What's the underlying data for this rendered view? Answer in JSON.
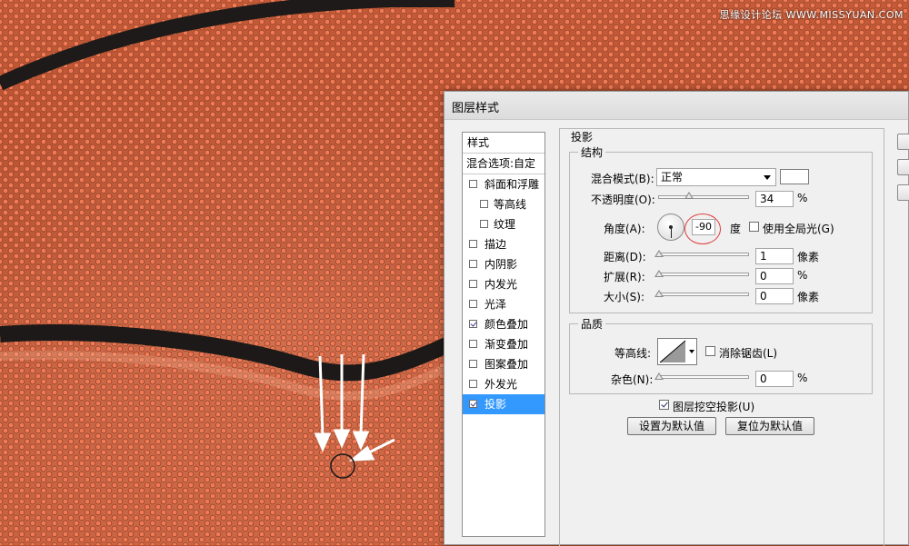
{
  "watermark": "思缘设计论坛 WWW.MISSYUAN.COM",
  "dialog": {
    "title": "图层样式"
  },
  "style_list": {
    "header": "样式",
    "blend_options": "混合选项:自定",
    "items": [
      {
        "label": "斜面和浮雕",
        "checked": false,
        "sub": false,
        "selected": false
      },
      {
        "label": "等高线",
        "checked": false,
        "sub": true,
        "selected": false
      },
      {
        "label": "纹理",
        "checked": false,
        "sub": true,
        "selected": false
      },
      {
        "label": "描边",
        "checked": false,
        "sub": false,
        "selected": false
      },
      {
        "label": "内阴影",
        "checked": false,
        "sub": false,
        "selected": false
      },
      {
        "label": "内发光",
        "checked": false,
        "sub": false,
        "selected": false
      },
      {
        "label": "光泽",
        "checked": false,
        "sub": false,
        "selected": false
      },
      {
        "label": "颜色叠加",
        "checked": true,
        "sub": false,
        "selected": false
      },
      {
        "label": "渐变叠加",
        "checked": false,
        "sub": false,
        "selected": false
      },
      {
        "label": "图案叠加",
        "checked": false,
        "sub": false,
        "selected": false
      },
      {
        "label": "外发光",
        "checked": false,
        "sub": false,
        "selected": false
      },
      {
        "label": "投影",
        "checked": true,
        "sub": false,
        "selected": true
      }
    ]
  },
  "drop_shadow": {
    "section_title": "投影",
    "structure": {
      "title": "结构",
      "blend_mode_label": "混合模式(B):",
      "blend_mode_value": "正常",
      "opacity_label": "不透明度(O):",
      "opacity_value": "34",
      "opacity_unit": "%",
      "opacity_fraction": 0.34,
      "angle_label": "角度(A):",
      "angle_value": "-90",
      "angle_unit": "度",
      "global_light_label": "使用全局光(G)",
      "global_light_checked": false,
      "distance_label": "距离(D):",
      "distance_value": "1",
      "distance_unit": "像素",
      "spread_label": "扩展(R):",
      "spread_value": "0",
      "spread_unit": "%",
      "size_label": "大小(S):",
      "size_value": "0",
      "size_unit": "像素"
    },
    "quality": {
      "title": "品质",
      "contour_label": "等高线:",
      "anti_alias_label": "消除锯齿(L)",
      "anti_alias_checked": false,
      "noise_label": "杂色(N):",
      "noise_value": "0",
      "noise_unit": "%"
    },
    "knockout_label": "图层挖空投影(U)",
    "knockout_checked": true,
    "make_default_label": "设置为默认值",
    "reset_default_label": "复位为默认值"
  },
  "colors": {
    "selection": "#3399ff",
    "annotation_red": "#e03a3a",
    "arrow": "#ffffff",
    "shadow_color": "#ffffff"
  }
}
